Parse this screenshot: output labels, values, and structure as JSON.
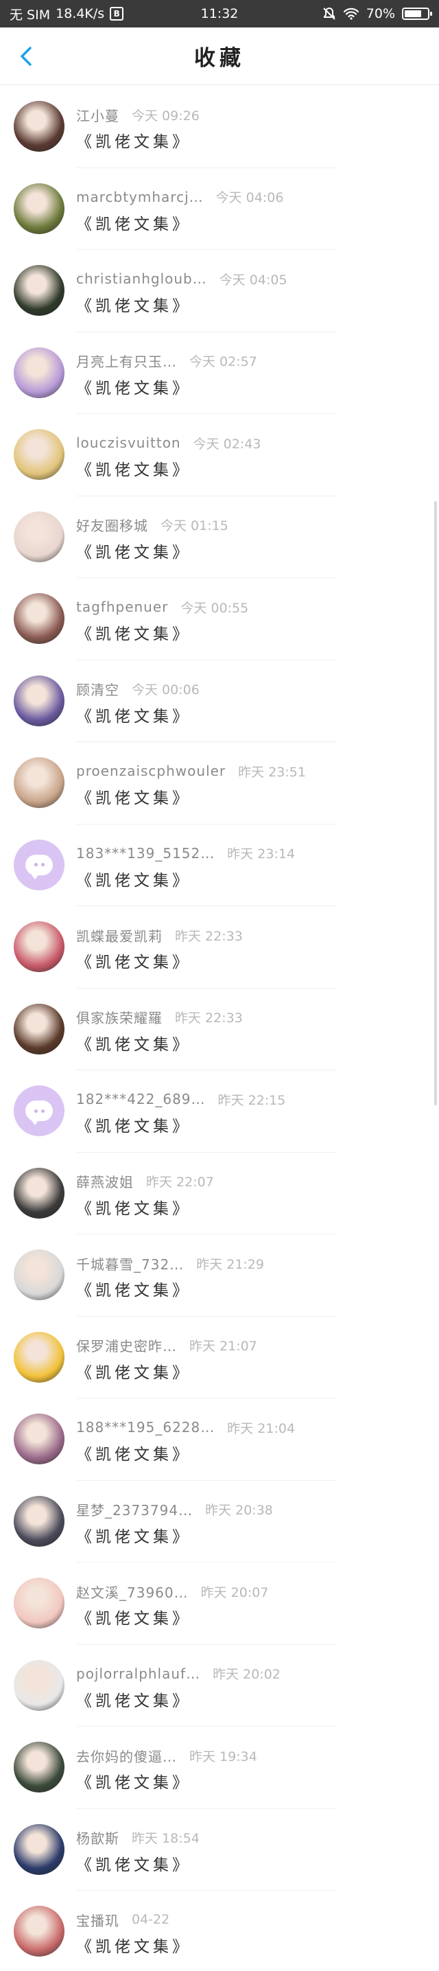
{
  "status_bar": {
    "carrier": "无 SIM",
    "speed": "18.4K/s",
    "time": "11:32",
    "battery": "70%"
  },
  "header": {
    "title": "收藏"
  },
  "colors": {
    "accent": "#1aa3e8",
    "placeholder_avatar": "#d9c4f3"
  },
  "favorites": [
    {
      "name": "江小蔓",
      "time": "今天 09:26",
      "book": "《凯佬文集》",
      "avatar": "#5a3a32"
    },
    {
      "name": "marcbtymharcj…",
      "time": "今天 04:06",
      "book": "《凯佬文集》",
      "avatar": "#6c7a3a"
    },
    {
      "name": "christianhgloub…",
      "time": "今天 04:05",
      "book": "《凯佬文集》",
      "avatar": "#2f3a2a"
    },
    {
      "name": "月亮上有只玉…",
      "time": "今天 02:57",
      "book": "《凯佬文集》",
      "avatar": "#b79ad8"
    },
    {
      "name": "louczisvuitton",
      "time": "今天 02:43",
      "book": "《凯佬文集》",
      "avatar": "#e2c47a"
    },
    {
      "name": "好友圈移城",
      "time": "今天 01:15",
      "book": "《凯佬文集》",
      "avatar": "#e8d6d0"
    },
    {
      "name": "tagfhpenuer",
      "time": "今天 00:55",
      "book": "《凯佬文集》",
      "avatar": "#8a5a52"
    },
    {
      "name": "顾清空",
      "time": "今天 00:06",
      "book": "《凯佬文集》",
      "avatar": "#6a5aa0"
    },
    {
      "name": "proenzaiscphwouler",
      "time": "昨天 23:51",
      "book": "《凯佬文集》",
      "avatar": "#c9a58a"
    },
    {
      "name": "183***139_5152…",
      "time": "昨天 23:14",
      "book": "《凯佬文集》",
      "avatar": ""
    },
    {
      "name": "凯蝶最爱凯莉",
      "time": "昨天 22:33",
      "book": "《凯佬文集》",
      "avatar": "#c95a6a"
    },
    {
      "name": "俱家族荣耀羅",
      "time": "昨天 22:33",
      "book": "《凯佬文集》",
      "avatar": "#5a3a2a"
    },
    {
      "name": "182***422_689…",
      "time": "昨天 22:15",
      "book": "《凯佬文集》",
      "avatar": ""
    },
    {
      "name": "薛燕波姐",
      "time": "昨天 22:07",
      "book": "《凯佬文集》",
      "avatar": "#3a3a3a"
    },
    {
      "name": "千城暮雪_732…",
      "time": "昨天 21:29",
      "book": "《凯佬文集》",
      "avatar": "#d8d8d8"
    },
    {
      "name": "保罗浦史密昨…",
      "time": "昨天 21:07",
      "book": "《凯佬文集》",
      "avatar": "#f2c23a"
    },
    {
      "name": "188***195_6228…",
      "time": "昨天 21:04",
      "book": "《凯佬文集》",
      "avatar": "#9a6a8a"
    },
    {
      "name": "星梦_2373794…",
      "time": "昨天 20:38",
      "book": "《凯佬文集》",
      "avatar": "#4a4a5a"
    },
    {
      "name": "赵文溪_73960…",
      "time": "昨天 20:07",
      "book": "《凯佬文集》",
      "avatar": "#f2c8c0"
    },
    {
      "name": "pojlorralphlauf…",
      "time": "昨天 20:02",
      "book": "《凯佬文集》",
      "avatar": "#e8e8e8"
    },
    {
      "name": "去你妈的傻逼…",
      "time": "昨天 19:34",
      "book": "《凯佬文集》",
      "avatar": "#3a4a3a"
    },
    {
      "name": "杨歆斯",
      "time": "昨天 18:54",
      "book": "《凯佬文集》",
      "avatar": "#2a3a6a"
    },
    {
      "name": "宝播玑",
      "time": "04-22",
      "book": "《凯佬文集》",
      "avatar": "#c96a6a"
    }
  ]
}
